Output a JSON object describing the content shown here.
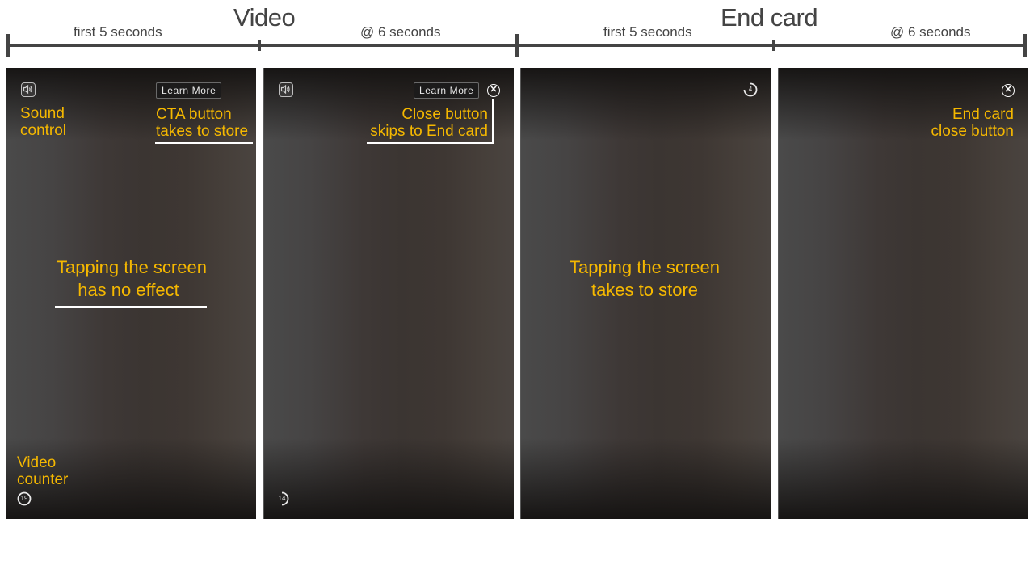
{
  "sections": {
    "video": {
      "title": "Video",
      "phase_1": "first 5 seconds",
      "phase_2": "@ 6 seconds"
    },
    "end_card": {
      "title": "End card",
      "phase_1": "first 5 seconds",
      "phase_2": "@ 6 seconds"
    }
  },
  "colors": {
    "annotation": "#f5b800",
    "timeline": "#444444",
    "underline": "#ffffff"
  },
  "panels": [
    {
      "id": "video-first-5s",
      "cta_label": "Learn More",
      "sound_icon": "speaker-icon",
      "counter_value": "19",
      "counter_progress": 1.0,
      "annotations": {
        "sound": "Sound\ncontrol",
        "sound_line1": "Sound",
        "sound_line2": "control",
        "cta_line1": "CTA button",
        "cta_line2": "takes to store",
        "tap_line1": "Tapping the screen",
        "tap_line2": "has no effect",
        "counter_line1": "Video",
        "counter_line2": "counter"
      }
    },
    {
      "id": "video-at-6s",
      "cta_label": "Learn More",
      "sound_icon": "speaker-icon",
      "close_icon": "close-circle-icon",
      "counter_value": "14",
      "counter_progress": 0.5,
      "annotations": {
        "close_line1": "Close button",
        "close_line2": "skips to End card"
      }
    },
    {
      "id": "endcard-first-5s",
      "counter_value": "4",
      "counter_progress": 0.8,
      "annotations": {
        "tap_line1": "Tapping the screen",
        "tap_line2": "takes to store"
      }
    },
    {
      "id": "endcard-at-6s",
      "close_icon": "close-circle-icon",
      "annotations": {
        "close_line1": "End card",
        "close_line2": "close button"
      }
    }
  ]
}
